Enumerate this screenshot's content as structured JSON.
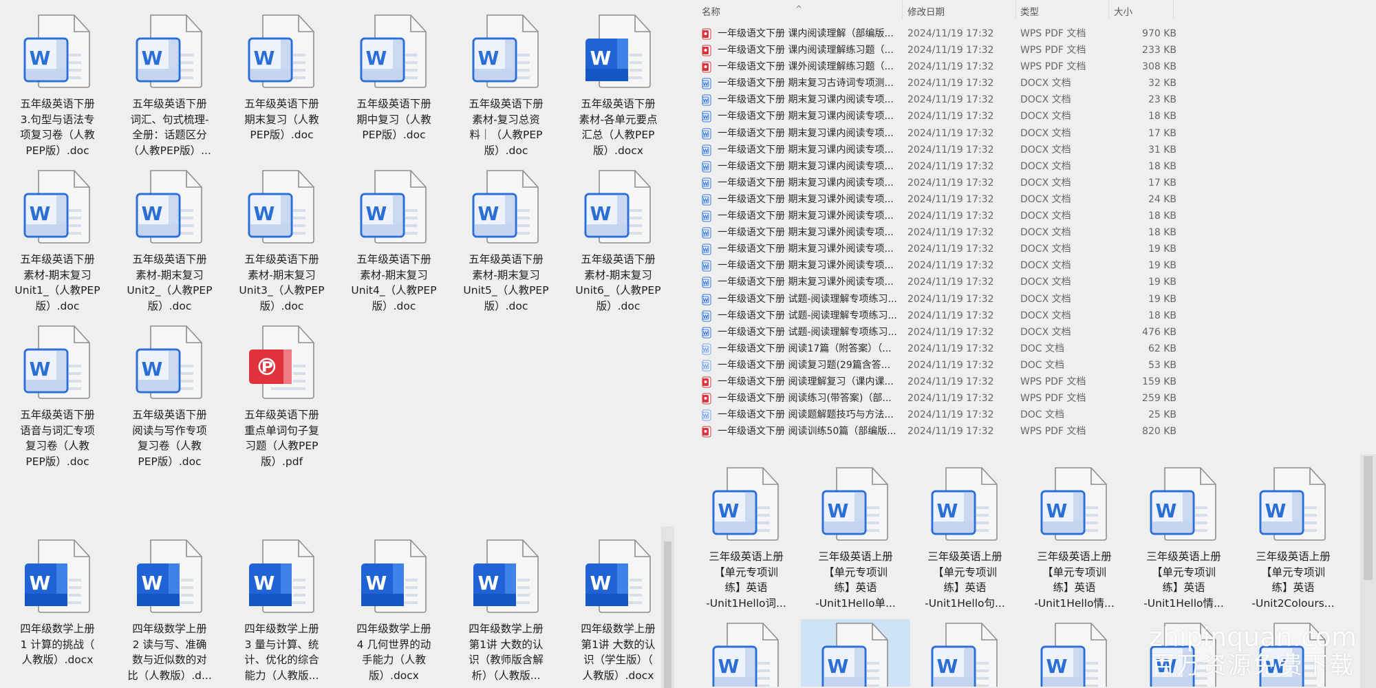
{
  "colors": {
    "word_blue": "#2b6fd6",
    "word_solid": "#1f63d6",
    "pdf_red": "#e0323c",
    "selection": "#cfe3f7"
  },
  "left_top_files": [
    {
      "name": "五年级英语下册\n3.句型与语法专\n项复习卷（人教\nPEP版）.doc",
      "icon": "word-light"
    },
    {
      "name": "五年级英语下册\n词汇、句式梳理-\n全册：话题区分\n（人教PEP版）...",
      "icon": "word-light"
    },
    {
      "name": "五年级英语下册\n期末复习（人教\nPEP版）.doc",
      "icon": "word-light"
    },
    {
      "name": "五年级英语下册\n期中复习（人教\nPEP版）.doc",
      "icon": "word-light"
    },
    {
      "name": "五年级英语下册\n素材-复习总资\n料｜（人教PEP\n版）.doc",
      "icon": "word-light"
    },
    {
      "name": "五年级英语下册\n素材-各单元要点\n汇总（人教PEP\n版）.docx",
      "icon": "word-solid"
    },
    {
      "name": "五年级英语下册\n素材-期末复习\nUnit1_（人教PEP\n版）.doc",
      "icon": "word-light"
    },
    {
      "name": "五年级英语下册\n素材-期末复习\nUnit2_（人教PEP\n版）.doc",
      "icon": "word-light"
    },
    {
      "name": "五年级英语下册\n素材-期末复习\nUnit3_（人教PEP\n版）.doc",
      "icon": "word-light"
    },
    {
      "name": "五年级英语下册\n素材-期末复习\nUnit4_（人教PEP\n版）.doc",
      "icon": "word-light"
    },
    {
      "name": "五年级英语下册\n素材-期末复习\nUnit5_（人教PEP\n版）.doc",
      "icon": "word-light"
    },
    {
      "name": "五年级英语下册\n素材-期末复习\nUnit6_（人教PEP\n版）.doc",
      "icon": "word-light"
    },
    {
      "name": "五年级英语下册\n语音与词汇专项\n复习卷（人教\nPEP版）.doc",
      "icon": "word-light"
    },
    {
      "name": "五年级英语下册\n阅读与写作专项\n复习卷（人教\nPEP版）.doc",
      "icon": "word-light"
    },
    {
      "name": "五年级英语下册\n重点单词句子复\n习题（人教PEP\n版）.pdf",
      "icon": "pdf"
    }
  ],
  "left_bottom_files": [
    {
      "name": "四年级数学上册\n1 计算的挑战（\n人教版）.docx",
      "icon": "word-solid"
    },
    {
      "name": "四年级数学上册\n2 读与写、准确\n数与近似数的对\n比（人教版）.d...",
      "icon": "word-solid"
    },
    {
      "name": "四年级数学上册\n3 量与计算、统\n计、优化的综合\n能力（人教版...",
      "icon": "word-solid"
    },
    {
      "name": "四年级数学上册\n4 几何世界的动\n手能力（人教\n版）.docx",
      "icon": "word-solid"
    },
    {
      "name": "四年级数学上册\n第1讲 大数的认\n识（教师版含解\n析）（人教版...",
      "icon": "word-solid"
    },
    {
      "name": "四年级数学上册\n第1讲 大数的认\n识（学生版）（\n人教版）.docx",
      "icon": "word-solid"
    }
  ],
  "list": {
    "headers": {
      "name": "名称",
      "date": "修改日期",
      "type": "类型",
      "size": "大小"
    },
    "rows": [
      {
        "name": "一年级语文下册  课内阅读理解（部编版...",
        "date": "2024/11/19 17:32",
        "type": "WPS PDF 文档",
        "size": "970 KB",
        "icon": "pdf"
      },
      {
        "name": "一年级语文下册  课内阅读理解练习题（...",
        "date": "2024/11/19 17:32",
        "type": "WPS PDF 文档",
        "size": "233 KB",
        "icon": "pdf"
      },
      {
        "name": "一年级语文下册  课外阅读理解练习题（...",
        "date": "2024/11/19 17:32",
        "type": "WPS PDF 文档",
        "size": "308 KB",
        "icon": "pdf"
      },
      {
        "name": "一年级语文下册  期末复习古诗词专项测...",
        "date": "2024/11/19 17:32",
        "type": "DOCX 文档",
        "size": "32 KB",
        "icon": "docx"
      },
      {
        "name": "一年级语文下册  期末复习课内阅读专项...",
        "date": "2024/11/19 17:32",
        "type": "DOCX 文档",
        "size": "23 KB",
        "icon": "docx"
      },
      {
        "name": "一年级语文下册  期末复习课内阅读专项...",
        "date": "2024/11/19 17:32",
        "type": "DOCX 文档",
        "size": "18 KB",
        "icon": "docx"
      },
      {
        "name": "一年级语文下册  期末复习课内阅读专项...",
        "date": "2024/11/19 17:32",
        "type": "DOCX 文档",
        "size": "17 KB",
        "icon": "docx"
      },
      {
        "name": "一年级语文下册  期末复习课内阅读专项...",
        "date": "2024/11/19 17:32",
        "type": "DOCX 文档",
        "size": "31 KB",
        "icon": "docx"
      },
      {
        "name": "一年级语文下册  期末复习课内阅读专项...",
        "date": "2024/11/19 17:32",
        "type": "DOCX 文档",
        "size": "18 KB",
        "icon": "docx"
      },
      {
        "name": "一年级语文下册  期末复习课内阅读专项...",
        "date": "2024/11/19 17:32",
        "type": "DOCX 文档",
        "size": "17 KB",
        "icon": "docx"
      },
      {
        "name": "一年级语文下册  期末复习课外阅读专项...",
        "date": "2024/11/19 17:32",
        "type": "DOCX 文档",
        "size": "24 KB",
        "icon": "docx"
      },
      {
        "name": "一年级语文下册  期末复习课外阅读专项...",
        "date": "2024/11/19 17:32",
        "type": "DOCX 文档",
        "size": "18 KB",
        "icon": "docx"
      },
      {
        "name": "一年级语文下册  期末复习课外阅读专项...",
        "date": "2024/11/19 17:32",
        "type": "DOCX 文档",
        "size": "18 KB",
        "icon": "docx"
      },
      {
        "name": "一年级语文下册  期末复习课外阅读专项...",
        "date": "2024/11/19 17:32",
        "type": "DOCX 文档",
        "size": "19 KB",
        "icon": "docx"
      },
      {
        "name": "一年级语文下册  期末复习课外阅读专项...",
        "date": "2024/11/19 17:32",
        "type": "DOCX 文档",
        "size": "19 KB",
        "icon": "docx"
      },
      {
        "name": "一年级语文下册  期末复习课外阅读专项...",
        "date": "2024/11/19 17:32",
        "type": "DOCX 文档",
        "size": "19 KB",
        "icon": "docx"
      },
      {
        "name": "一年级语文下册  试题-阅读理解专项练习...",
        "date": "2024/11/19 17:32",
        "type": "DOCX 文档",
        "size": "19 KB",
        "icon": "docx"
      },
      {
        "name": "一年级语文下册  试题-阅读理解专项练习...",
        "date": "2024/11/19 17:32",
        "type": "DOCX 文档",
        "size": "18 KB",
        "icon": "docx"
      },
      {
        "name": "一年级语文下册  试题-阅读理解专项练习...",
        "date": "2024/11/19 17:32",
        "type": "DOCX 文档",
        "size": "476 KB",
        "icon": "docx"
      },
      {
        "name": "一年级语文下册  阅读17篇（附答案）（...",
        "date": "2024/11/19 17:32",
        "type": "DOC 文档",
        "size": "62 KB",
        "icon": "doc"
      },
      {
        "name": "一年级语文下册  阅读复习题(29篇含答...",
        "date": "2024/11/19 17:32",
        "type": "DOC 文档",
        "size": "53 KB",
        "icon": "doc"
      },
      {
        "name": "一年级语文下册  阅读理解复习（课内课...",
        "date": "2024/11/19 17:32",
        "type": "WPS PDF 文档",
        "size": "159 KB",
        "icon": "pdf"
      },
      {
        "name": "一年级语文下册  阅读练习(带答案)（部...",
        "date": "2024/11/19 17:32",
        "type": "WPS PDF 文档",
        "size": "259 KB",
        "icon": "pdf"
      },
      {
        "name": "一年级语文下册  阅读题解题技巧与方法...",
        "date": "2024/11/19 17:32",
        "type": "DOC 文档",
        "size": "25 KB",
        "icon": "doc"
      },
      {
        "name": "一年级语文下册  阅读训练50篇（部编版...",
        "date": "2024/11/19 17:32",
        "type": "WPS PDF 文档",
        "size": "820 KB",
        "icon": "pdf"
      }
    ]
  },
  "right_bottom_files": [
    {
      "name": "三年级英语上册\n【单元专项训\n练】英语\n-Unit1Hello词...",
      "icon": "word-light"
    },
    {
      "name": "三年级英语上册\n【单元专项训\n练】英语\n-Unit1Hello单...",
      "icon": "word-light"
    },
    {
      "name": "三年级英语上册\n【单元专项训\n练】英语\n-Unit1Hello句...",
      "icon": "word-light"
    },
    {
      "name": "三年级英语上册\n【单元专项训\n练】英语\n-Unit1Hello情...",
      "icon": "word-light"
    },
    {
      "name": "三年级英语上册\n【单元专项训\n练】英语\n-Unit1Hello情...",
      "icon": "word-light"
    },
    {
      "name": "三年级英语上册\n【单元专项训\n练】英语\n-Unit2Colours...",
      "icon": "word-light"
    },
    {
      "name": "",
      "icon": "word-light"
    },
    {
      "name": "",
      "icon": "word-light",
      "selected": true
    },
    {
      "name": "",
      "icon": "word-light"
    },
    {
      "name": "",
      "icon": "word-light"
    },
    {
      "name": "",
      "icon": "word-light"
    },
    {
      "name": "",
      "icon": "word-light"
    }
  ],
  "watermark": {
    "line1": "zhipinquan.com",
    "line2": "百万资源免费下载"
  }
}
